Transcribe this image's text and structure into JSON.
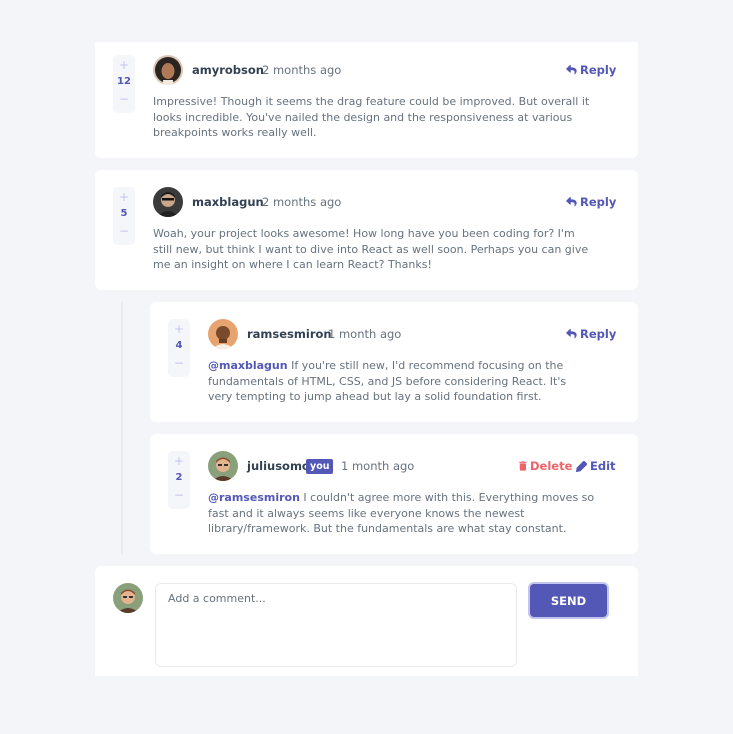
{
  "comments": [
    {
      "username": "amyrobson",
      "time": "2 months ago",
      "score": "12",
      "reply_label": "Reply",
      "text": "Impressive! Though it seems the drag feature could be improved. But overall it looks incredible. You've nailed the design and the responsiveness at various breakpoints works really well."
    },
    {
      "username": "maxblagun",
      "time": "2 months ago",
      "score": "5",
      "reply_label": "Reply",
      "text": "Woah, your project looks awesome! How long have you been coding for? I'm still new, but think I want to dive into React as well soon. Perhaps you can give me an insight on where I can learn React? Thanks!"
    }
  ],
  "replies": [
    {
      "username": "ramsesmiron",
      "time": "1 month ago",
      "score": "4",
      "reply_label": "Reply",
      "mention": "@maxblagun",
      "text": "If you're still new, I'd recommend focusing on the fundamentals of HTML, CSS, and JS before considering React. It's very tempting to jump ahead but lay a solid foundation first."
    },
    {
      "username": "juliusomo",
      "you_badge": "you",
      "time": "1 month ago",
      "score": "2",
      "delete_label": "Delete",
      "edit_label": "Edit",
      "mention": "@ramsesmiron",
      "text": "I couldn't agree more with this. Everything moves so fast and it always seems like everyone knows the newest library/framework. But the fundamentals are what stay constant."
    }
  ],
  "vote": {
    "plus": "+",
    "minus": "−"
  },
  "composer": {
    "placeholder": "Add a comment...",
    "send_label": "SEND"
  },
  "colors": {
    "primary": "#5357b6",
    "danger": "#ed6368",
    "text_dark": "#334253",
    "text_body": "#67727e",
    "background": "#f4f5f8"
  },
  "icons": {
    "reply": "reply-icon",
    "delete": "trash-icon",
    "edit": "pencil-icon"
  }
}
